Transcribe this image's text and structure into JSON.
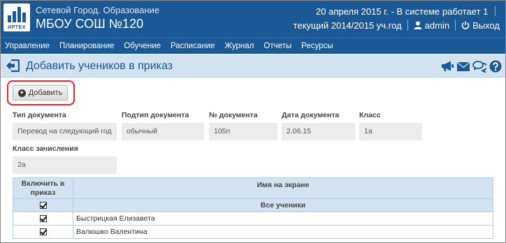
{
  "header": {
    "app_name": "Сетевой Город. Образование",
    "school_name": "МБОУ СОШ №120",
    "logo_text": "ИРТЕХ",
    "date_text": "20 апреля 2015 г. -",
    "online_text": "В системе работает 1",
    "year_text": "текущий 2014/2015 уч.год",
    "user_label": "admin",
    "logout_label": "Выход"
  },
  "menu": {
    "items": [
      "Управление",
      "Планирование",
      "Обучение",
      "Расписание",
      "Журнал",
      "Отчеты",
      "Ресурсы"
    ]
  },
  "page": {
    "title": "Добавить учеников в приказ",
    "add_button_label": "Добавить"
  },
  "fields": {
    "doc_type": {
      "label": "Тип документа",
      "value": "Перевод на следующий год"
    },
    "doc_subtype": {
      "label": "Подтип документа",
      "value": "обычный"
    },
    "doc_number": {
      "label": "№ документа",
      "value": "105п"
    },
    "doc_date": {
      "label": "Дата документа",
      "value": "2.06.15"
    },
    "class": {
      "label": "Класс",
      "value": "1а"
    },
    "enroll_class": {
      "label": "Класс зачисления",
      "value": "2а"
    }
  },
  "table": {
    "headers": [
      "Включить в приказ",
      "Имя на экране"
    ],
    "all_label": "Все ученики",
    "rows": [
      {
        "name": "Быстрицкая Елизавета",
        "checked": true
      },
      {
        "name": "Валюшко Валентина",
        "checked": true
      }
    ]
  },
  "colors": {
    "header_bg": "#1b5896",
    "titlebar_bg": "#d3e2f1",
    "highlight": "#e8262b"
  }
}
